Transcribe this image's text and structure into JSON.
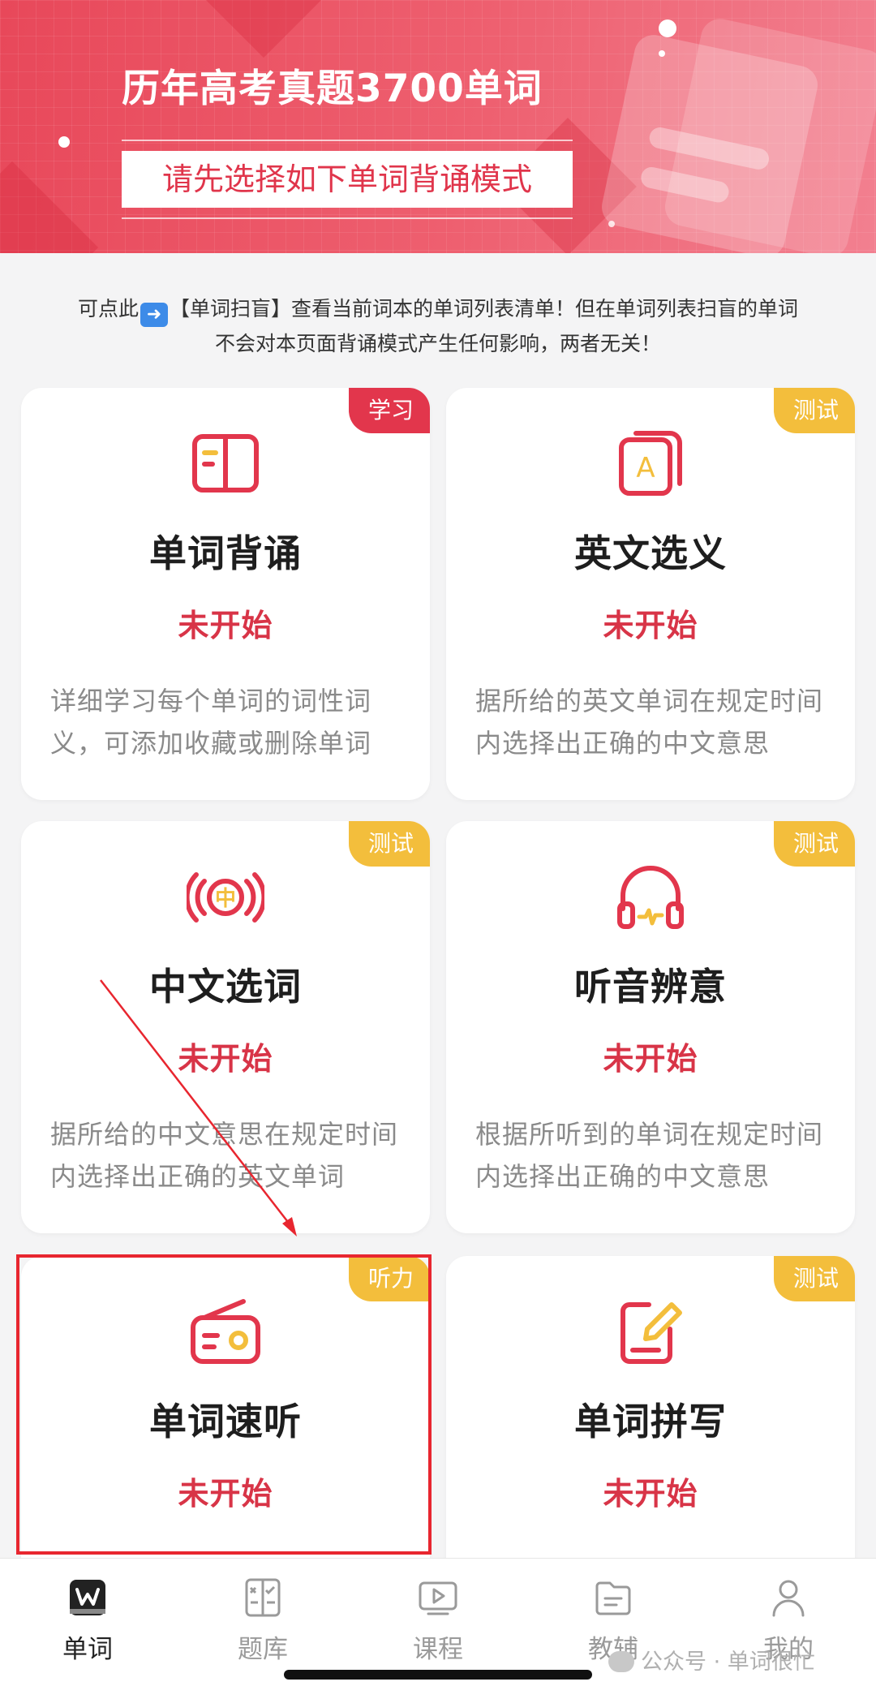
{
  "banner": {
    "title": "历年高考真题3700单词",
    "subtitle": "请先选择如下单词背诵模式"
  },
  "notice": {
    "prefix": "可点此",
    "arrow_icon": "right-arrow-emoji",
    "link": "【单词扫盲】",
    "line1_rest": "查看当前词本的单词列表清单！但在单词列表扫盲的单词",
    "line2": "不会对本页面背诵模式产生任何影响，两者无关！"
  },
  "cards": [
    {
      "tag": "学习",
      "tag_color": "#e2364c",
      "icon": "book-open-icon",
      "title": "单词背诵",
      "status": "未开始",
      "desc": "详细学习每个单词的词性词义，可添加收藏或删除单词"
    },
    {
      "tag": "测试",
      "tag_color": "#f3be3c",
      "icon": "letter-a-card-icon",
      "title": "英文选义",
      "status": "未开始",
      "desc": "据所给的英文单词在规定时间内选择出正确的中文意思"
    },
    {
      "tag": "测试",
      "tag_color": "#f3be3c",
      "icon": "chinese-sound-icon",
      "title": "中文选词",
      "status": "未开始",
      "desc": "据所给的中文意思在规定时间内选择出正确的英文单词"
    },
    {
      "tag": "测试",
      "tag_color": "#f3be3c",
      "icon": "headphones-icon",
      "title": "听音辨意",
      "status": "未开始",
      "desc": "根据所听到的单词在规定时间内选择出正确的中文意思"
    },
    {
      "tag": "听力",
      "tag_color": "#f3be3c",
      "icon": "radio-icon",
      "title": "单词速听",
      "status": "未开始",
      "desc": ""
    },
    {
      "tag": "测试",
      "tag_color": "#f3be3c",
      "icon": "pencil-edit-icon",
      "title": "单词拼写",
      "status": "未开始",
      "desc": ""
    }
  ],
  "icon_glyphs": {
    "chinese_char": "中",
    "letter": "A"
  },
  "tabbar": {
    "items": [
      {
        "label": "单词",
        "icon": "word-book-icon",
        "active": true
      },
      {
        "label": "题库",
        "icon": "question-bank-icon",
        "active": false
      },
      {
        "label": "课程",
        "icon": "video-course-icon",
        "active": false
      },
      {
        "label": "教辅",
        "icon": "folder-materials-icon",
        "active": false
      },
      {
        "label": "我的",
        "icon": "user-profile-icon",
        "active": false
      }
    ]
  },
  "watermark": "公众号 · 单词很忙",
  "colors": {
    "accent_red": "#e2364c",
    "tag_yellow": "#f3be3c",
    "status_red": "#d83447",
    "highlight_box": "#e8262f"
  }
}
